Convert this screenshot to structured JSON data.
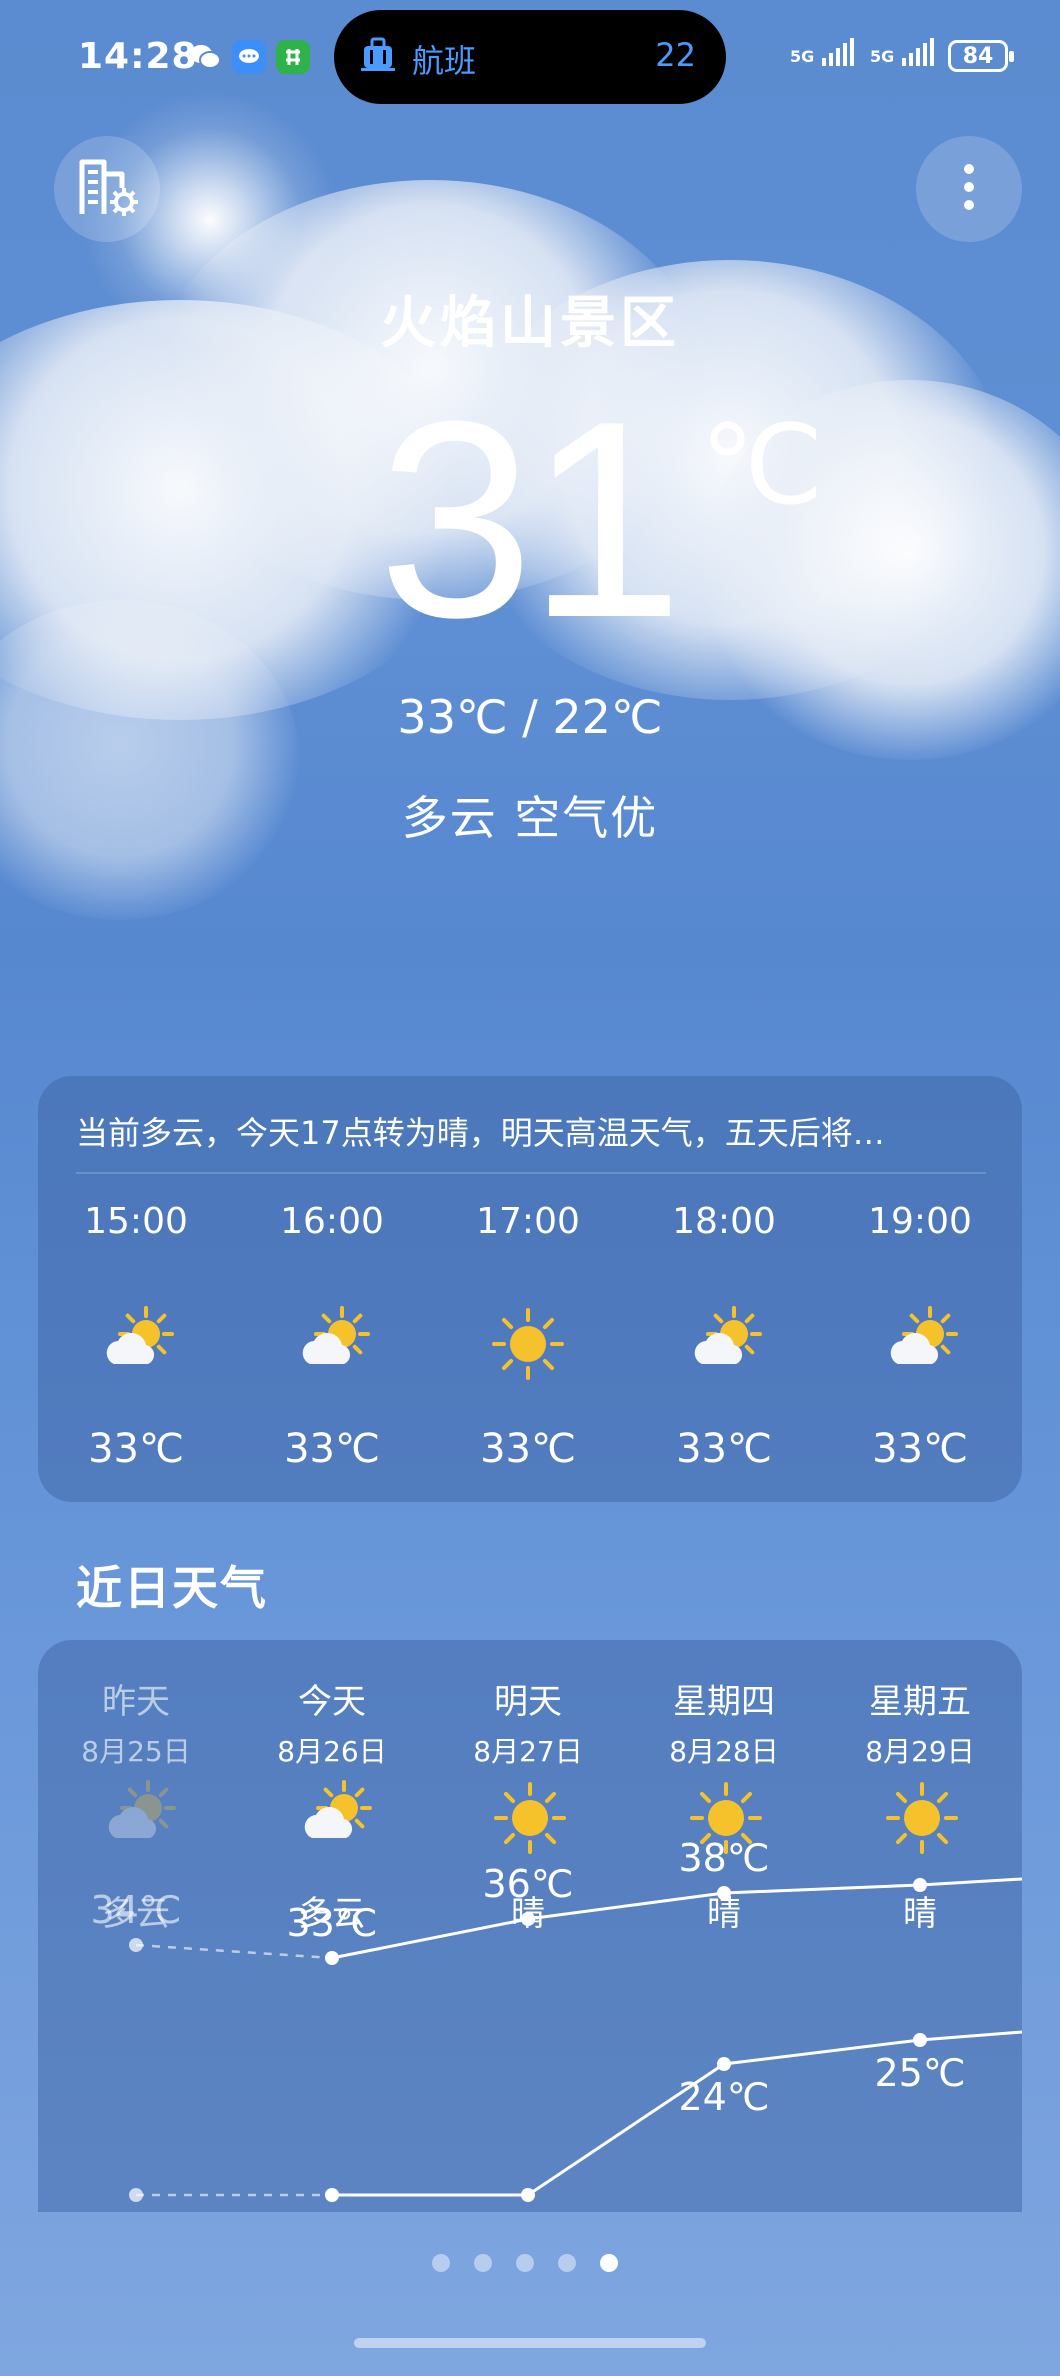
{
  "status_bar": {
    "time": "14:28",
    "flight_label": "航班",
    "flight_count": "22",
    "signal1": "5G",
    "signal2": "5G",
    "battery": "84"
  },
  "header": {
    "city_manage_icon": "city-settings-icon",
    "more_icon": "more-vertical-icon"
  },
  "current": {
    "city": "火焰山景区",
    "temperature": "31",
    "unit": "℃",
    "range": "33℃ / 22℃",
    "condition": "多云  空气优"
  },
  "hourly": {
    "summary": "当前多云，今天17点转为晴，明天高温天气，五天后将…",
    "items": [
      {
        "time": "15:00",
        "icon": "partly-cloudy-icon",
        "temp": "33℃"
      },
      {
        "time": "16:00",
        "icon": "partly-cloudy-icon",
        "temp": "33℃"
      },
      {
        "time": "17:00",
        "icon": "sunny-icon",
        "temp": "33℃"
      },
      {
        "time": "18:00",
        "icon": "partly-cloudy-icon",
        "temp": "33℃"
      },
      {
        "time": "19:00",
        "icon": "partly-cloudy-icon",
        "temp": "33℃"
      }
    ]
  },
  "daily": {
    "title": "近日天气",
    "items": [
      {
        "day": "昨天",
        "date": "8月25日",
        "icon": "partly-cloudy-icon",
        "cond": "多云",
        "high": "34℃",
        "low": "",
        "past": true
      },
      {
        "day": "今天",
        "date": "8月26日",
        "icon": "partly-cloudy-icon",
        "cond": "多云",
        "high": "33℃",
        "low": "",
        "past": false
      },
      {
        "day": "明天",
        "date": "8月27日",
        "icon": "sunny-icon",
        "cond": "晴",
        "high": "36℃",
        "low": "",
        "past": false
      },
      {
        "day": "星期四",
        "date": "8月28日",
        "icon": "sunny-icon",
        "cond": "晴",
        "high": "38℃",
        "low": "24℃",
        "past": false
      },
      {
        "day": "星期五",
        "date": "8月29日",
        "icon": "sunny-icon",
        "cond": "晴",
        "high": "",
        "low": "25℃",
        "past": false
      }
    ]
  },
  "pager": {
    "count": 5,
    "active": 4
  },
  "colors": {
    "sun": "#f6c22c",
    "pill_text": "#4a9bff",
    "card_bg": "rgba(58,96,160,0.45)"
  }
}
